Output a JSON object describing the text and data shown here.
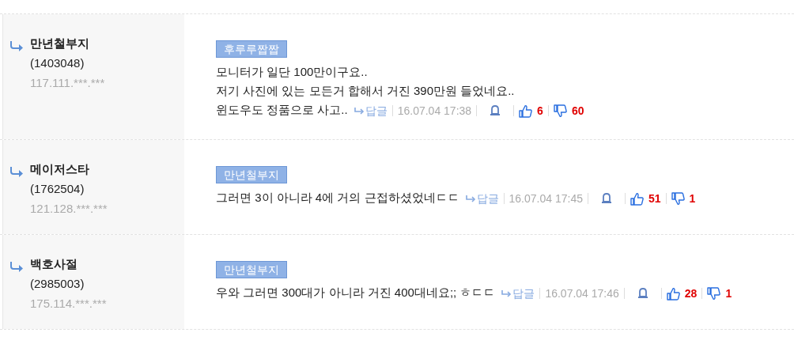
{
  "comments": [
    {
      "author": "만년철부지",
      "user_id": "(1403048)",
      "ip": "117.111.***.***",
      "reply_to": "후루루짭짭",
      "lines": [
        "모니터가 일단 100만이구요..",
        "저기 사진에 있는 모든거 합해서 거진 390만원 들었네요..",
        "윈도우도 정품으로 사고.."
      ],
      "reply_label": "답글",
      "time": "16.07.04 17:38",
      "likes": "6",
      "dislikes": "60"
    },
    {
      "author": "메이저스타",
      "user_id": "(1762504)",
      "ip": "121.128.***.***",
      "reply_to": "만년철부지",
      "lines": [
        "그러면 3이 아니라 4에 거의 근접하셨었네ㄷㄷ"
      ],
      "reply_label": "답글",
      "time": "16.07.04 17:45",
      "likes": "51",
      "dislikes": "1"
    },
    {
      "author": "백호사절",
      "user_id": "(2985003)",
      "ip": "175.114.***.***",
      "reply_to": "만년철부지",
      "lines": [
        "우와 그러면 300대가 아니라 거진 400대네요;; ㅎㄷㄷ"
      ],
      "reply_label": "답글",
      "time": "16.07.04 17:46",
      "likes": "28",
      "dislikes": "1"
    }
  ]
}
